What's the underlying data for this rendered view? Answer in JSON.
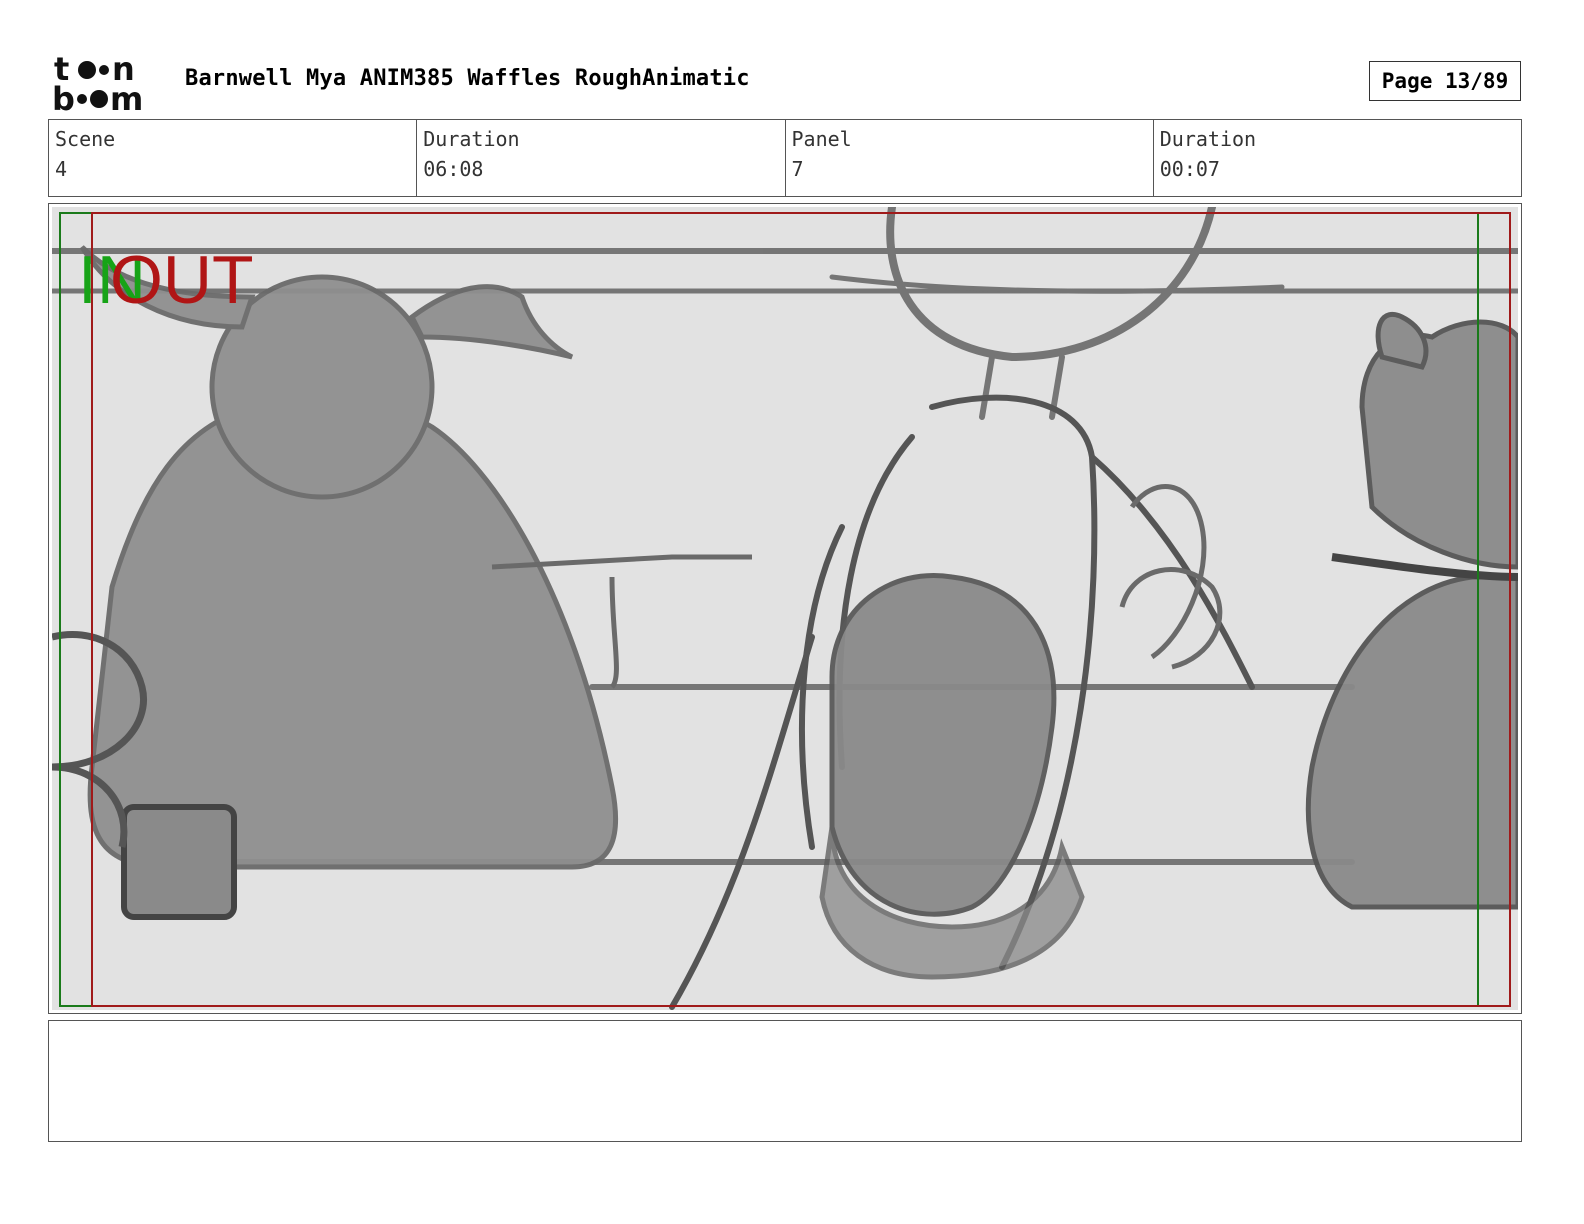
{
  "header": {
    "logo": {
      "icon": "toon-boom-logo",
      "line1": "toon",
      "line2": "boom"
    },
    "title": "Barnwell Mya ANIM385 Waffles RoughAnimatic",
    "page": "Page 13/89"
  },
  "info": {
    "scene_label": "Scene",
    "scene_value": "4",
    "scene_duration_label": "Duration",
    "scene_duration_value": "06:08",
    "panel_label": "Panel",
    "panel_value": "7",
    "panel_duration_label": "Duration",
    "panel_duration_value": "00:07"
  },
  "panel": {
    "in_marker": "IN",
    "out_marker": "OUT",
    "colors": {
      "in": "#17a317",
      "out": "#b01515",
      "background": "#e2e2e2",
      "sketch": "#6a6a6a"
    }
  },
  "notes": {
    "text": ""
  }
}
